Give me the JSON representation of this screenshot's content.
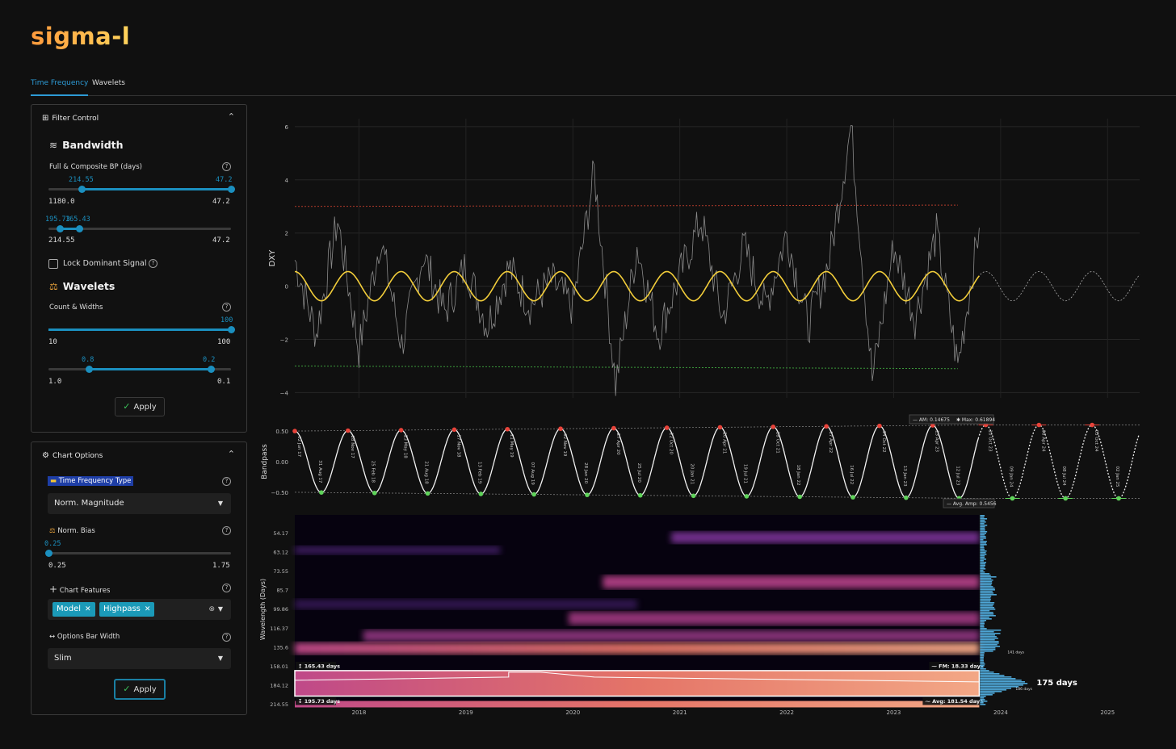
{
  "app": {
    "title": "sigma-l"
  },
  "tabs": [
    {
      "label": "Time Frequency",
      "active": true
    },
    {
      "label": "Wavelets",
      "active": false
    }
  ],
  "filter_control": {
    "title": "Filter Control",
    "bandwidth": {
      "title": "Bandwidth",
      "label": "Full & Composite BP (days)",
      "slider1": {
        "value_low": "214.55",
        "value_high": "47.2",
        "min_label": "1180.0",
        "max_label": "47.2",
        "low_frac": 0.18,
        "high_frac": 1.0
      },
      "slider2": {
        "value_low": "195.73",
        "value_high": "165.43",
        "min_label": "214.55",
        "max_label": "47.2",
        "low_frac": 0.06,
        "high_frac": 0.17
      }
    },
    "lock_dominant": {
      "label": "Lock Dominant Signal",
      "checked": false
    },
    "wavelets": {
      "title": "Wavelets",
      "label": "Count & Widths",
      "slider1": {
        "value": "100",
        "min_label": "10",
        "max_label": "100",
        "frac": 1.0
      },
      "slider2": {
        "value_low": "0.8",
        "value_high": "0.2",
        "min_label": "1.0",
        "max_label": "0.1",
        "low_frac": 0.22,
        "high_frac": 0.89
      }
    },
    "apply_label": "Apply"
  },
  "chart_options": {
    "title": "Chart Options",
    "tf_type": {
      "label": "Time Frequency Type",
      "value": "Norm. Magnitude"
    },
    "norm_bias": {
      "label": "Norm. Bias",
      "value": "0.25",
      "min_label": "0.25",
      "max_label": "1.75",
      "frac": 0.0
    },
    "features": {
      "label": "Chart Features",
      "chips": [
        "Model",
        "Highpass"
      ]
    },
    "bar_width": {
      "label": "Options Bar Width",
      "value": "Slim"
    },
    "apply_label": "Apply"
  },
  "icons": {
    "filter": "grid-icon",
    "bandwidth": "waves-icon",
    "wavelets": "balance-icon",
    "options": "gear-icon",
    "norm": "balance-icon",
    "features": "plus-icon",
    "width": "arrows-horizontal-icon"
  },
  "colors": {
    "accent": "#1b8fbf",
    "signal": "#f2cd3a",
    "peak": "#e8433a",
    "trough": "#5fd35a"
  },
  "chart_data": [
    {
      "type": "line",
      "ylabel": "DXY",
      "yticks": [
        "6",
        "4",
        "2",
        "0",
        "−2",
        "−4"
      ],
      "yvalues": [
        6,
        4,
        2,
        0,
        -2,
        -4
      ],
      "ylim": [
        -4.2,
        6.3
      ],
      "series": [
        {
          "kind": "price",
          "x": [
            2017.4,
            2017.6,
            2017.8,
            2018.0,
            2018.2,
            2018.4,
            2018.6,
            2018.8,
            2019.0,
            2019.2,
            2019.4,
            2019.6,
            2019.8,
            2020.0,
            2020.2,
            2020.4,
            2020.6,
            2020.8,
            2021.0,
            2021.2,
            2021.4,
            2021.6,
            2021.8,
            2022.0,
            2022.2,
            2022.4,
            2022.6,
            2022.8,
            2023.0,
            2023.2,
            2023.4,
            2023.6,
            2023.8
          ],
          "y": [
            1.0,
            -1.8,
            2.5,
            -2.4,
            1.8,
            -2.2,
            1.2,
            -1.0,
            0.8,
            -1.5,
            0.7,
            -0.7,
            0.2,
            -0.8,
            4.3,
            -3.7,
            1.5,
            -1.8,
            0.4,
            2.5,
            -1.2,
            1.5,
            -0.8,
            2.0,
            -1.5,
            1.0,
            6.0,
            -3.5,
            1.5,
            -1.2,
            2.0,
            -3.0,
            2.2
          ]
        },
        {
          "kind": "model_wave",
          "period_days": 181.54,
          "amplitude": 0.55
        },
        {
          "kind": "upper_band",
          "y": 3.0
        },
        {
          "kind": "lower_band",
          "y": -3.0
        }
      ]
    },
    {
      "type": "line",
      "ylabel": "Bandpass",
      "yticks": [
        "0.50",
        "0.00",
        "−0.50"
      ],
      "yvalues": [
        0.5,
        0.0,
        -0.5
      ],
      "annotations": {
        "am": "AM: 0.14675",
        "max": "Max: 0.61894",
        "avg_amp": "Avg. Amp: 0.5456"
      },
      "peak_labels": [
        "02 Jun 17",
        "28 Nov 17",
        "23 May 18",
        "17 Nov 18",
        "11 May 19",
        "02 Nov 19",
        "27 Apr 20",
        "22 Oct 20",
        "20 Apr 21",
        "18 Oct 21",
        "17 Apr 22",
        "14 Oct 22",
        "13 Apr 23",
        "10 Oct 23",
        "08 Apr 24",
        "03 Oct 24",
        "01 Jan 25"
      ],
      "trough_labels": [
        "31 Aug 17",
        "25 Feb 18",
        "21 Aug 18",
        "13 Feb 19",
        "07 Aug 19",
        "28 Jan 20",
        "25 Jul 20",
        "20 Jan 21",
        "19 Jul 21",
        "18 Jan 22",
        "16 Jul 22",
        "13 Jan 23",
        "12 Jul 23",
        "09 Jan 24",
        "08 Jul 24",
        "02 Jan 25"
      ]
    },
    {
      "type": "heatmap",
      "ylabel": "Wavelength (Days)",
      "yticks": [
        "54.17",
        "63.12",
        "73.55",
        "85.7",
        "99.86",
        "116.37",
        "135.6",
        "158.01",
        "184.12",
        "214.55"
      ],
      "xticks": [
        "2018",
        "2019",
        "2020",
        "2021",
        "2022",
        "2023",
        "2024",
        "2025"
      ],
      "xvalues": [
        2018,
        2019,
        2020,
        2021,
        2022,
        2023,
        2024,
        2025
      ],
      "xlim": [
        2017.4,
        2025.3
      ],
      "band_labels": {
        "upper": "165.43 days",
        "lower": "195.73 days",
        "fm": "FM: 18.33 days",
        "avg": "Avg: 181.54 days"
      },
      "histogram_labels": {
        "peak": "175 days",
        "small1": "141 days",
        "small2": "186 days"
      }
    }
  ]
}
